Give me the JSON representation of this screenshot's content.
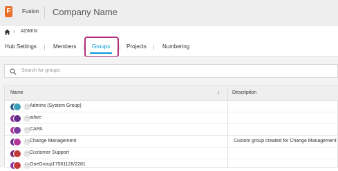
{
  "header": {
    "logo_letter": "F",
    "app_name": "Fusion",
    "company_name": "Company Name",
    "logo_color": "#e8702a"
  },
  "breadcrumb": {
    "home_icon": "home-icon",
    "current": "ADMIN"
  },
  "tabs": [
    {
      "label": "Hub Settings",
      "active": false
    },
    {
      "label": "Members",
      "active": false
    },
    {
      "label": "Groups",
      "active": true
    },
    {
      "label": "Projects",
      "active": false
    },
    {
      "label": "Numbering",
      "active": false
    }
  ],
  "search": {
    "placeholder": "Search for groups"
  },
  "table": {
    "columns": {
      "name": "Name",
      "description": "Description"
    },
    "sort_icon": "arrow-up-icon",
    "rows": [
      {
        "name": "Admins (System Group)",
        "description": "",
        "avatar_colors": [
          "#2b5f8a",
          "#3aa0b8"
        ]
      },
      {
        "name": "adwe",
        "description": "",
        "avatar_colors": [
          "#8a2f9a",
          "#6a2c8c"
        ]
      },
      {
        "name": "CAPA",
        "description": "",
        "avatar_colors": [
          "#b3369a",
          "#7a3aa0"
        ]
      },
      {
        "name": "Change Management",
        "description": "Custom group created for Change Management",
        "avatar_colors": [
          "#6a2c8c",
          "#b3369a"
        ]
      },
      {
        "name": "Customer Support",
        "description": "",
        "avatar_colors": [
          "#7a1f6a",
          "#c23a3a"
        ]
      },
      {
        "name": "OneGroup17561128/2281",
        "description": "",
        "avatar_colors": [
          "#8a2f9a",
          "#c23a3a"
        ]
      }
    ]
  },
  "accent_color": "#0696d7",
  "highlight_color": "#b0307f"
}
